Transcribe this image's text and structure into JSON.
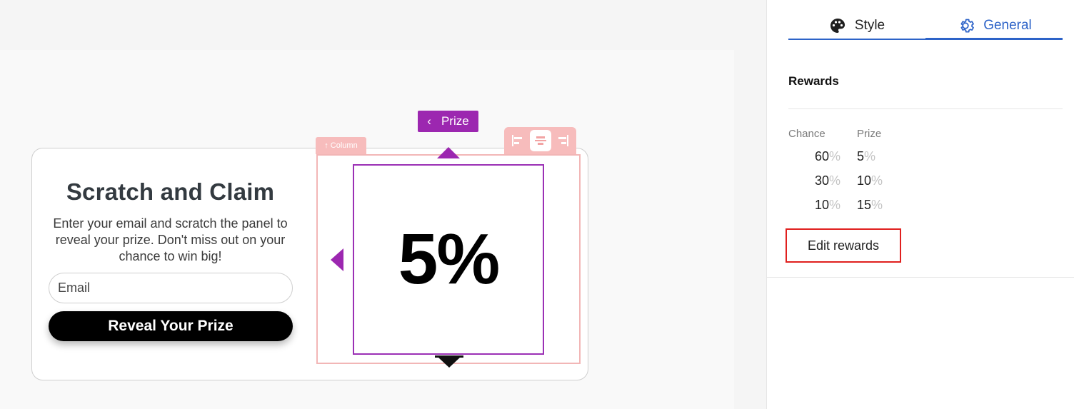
{
  "canvas": {
    "headline": "Scratch and Claim",
    "description": "Enter your email and scratch the panel to reveal your prize. Don't miss out on your chance to win big!",
    "email_placeholder": "Email",
    "reveal_button": "Reveal Your Prize",
    "column_tag": "Column",
    "prize_label": "Prize",
    "prize_value": "5%"
  },
  "panel": {
    "tabs": [
      {
        "label": "Style",
        "icon": "palette-icon",
        "active": false
      },
      {
        "label": "General",
        "icon": "gear-icon",
        "active": true
      }
    ],
    "section_title": "Rewards",
    "columns": {
      "chance": "Chance",
      "prize": "Prize"
    },
    "rewards": [
      {
        "chance": "60",
        "prize": "5"
      },
      {
        "chance": "30",
        "prize": "10"
      },
      {
        "chance": "10",
        "prize": "15"
      }
    ],
    "percent_sign": "%",
    "edit_button": "Edit rewards"
  },
  "colors": {
    "accent_blue": "#2d63c8",
    "prize_purple": "#9c27b0",
    "column_pink": "#f7bcbc",
    "highlight_red": "#e0201e"
  }
}
